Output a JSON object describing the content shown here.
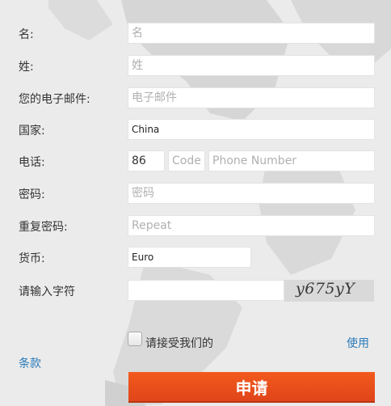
{
  "form": {
    "first_name": {
      "label": "名:",
      "placeholder": "名"
    },
    "last_name": {
      "label": "姓:",
      "placeholder": "姓"
    },
    "email": {
      "label": "您的电子邮件:",
      "placeholder": "电子邮件"
    },
    "country": {
      "label": "国家:",
      "value": "China"
    },
    "phone": {
      "label": "电话:",
      "country_code": "86",
      "area_placeholder": "Code",
      "number_placeholder": "Phone Number"
    },
    "password": {
      "label": "密码:",
      "placeholder": "密码"
    },
    "repeat_password": {
      "label": "重复密码:",
      "placeholder": "Repeat"
    },
    "currency": {
      "label": "货币:",
      "value": "Euro"
    },
    "captcha": {
      "label": "请输入字符",
      "image_text": "y675yY"
    },
    "agree": {
      "text": "请接受我们的",
      "link1": "使用",
      "link2": "条款"
    },
    "submit_label": "申请"
  },
  "colors": {
    "submit": "#e84e1b",
    "link": "#2a7ab8",
    "background": "#ebebeb"
  }
}
